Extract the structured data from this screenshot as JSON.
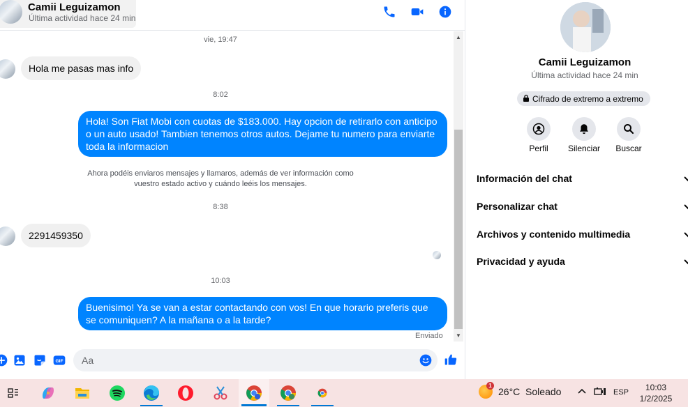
{
  "contact": {
    "name": "Camii Leguizamon",
    "status": "Última actividad hace 24 min"
  },
  "header_icons": [
    "phone-icon",
    "video-camera-icon",
    "info-icon"
  ],
  "conversation": {
    "ts1": "vie, 19:47",
    "msg1": "Hola me pasas mas info",
    "ts2": "8:02",
    "msg2": "Hola! Son Fiat Mobi con cuotas de $183.000. Hay opcion de retirarlo con anticipo o un auto usado! Tambien tenemos otros autos. Dejame tu numero para enviarte toda la informacion",
    "notice": "Ahora podéis enviaros mensajes y llamaros, además de ver información como vuestro estado activo y cuándo leéis los mensajes.",
    "ts3": "8:38",
    "msg3": "2291459350",
    "ts4": "10:03",
    "msg4": "Buenisimo! Ya se van a estar contactando con vos! En que horario preferis que se comuniquen? A la mañana o a la tarde?",
    "sent_status": "Enviado"
  },
  "composer": {
    "placeholder": "Aa",
    "icons": [
      "add-icon",
      "image-icon",
      "sticker-icon",
      "gif-icon",
      "emoji-icon",
      "like-icon"
    ]
  },
  "side_panel": {
    "encryption": "Cifrado de extremo a extremo",
    "actions": {
      "profile": "Perfil",
      "mute": "Silenciar",
      "search": "Buscar"
    },
    "sections": {
      "chat_info": "Información del chat",
      "customize": "Personalizar chat",
      "media": "Archivos y contenido multimedia",
      "privacy": "Privacidad y ayuda"
    }
  },
  "taskbar": {
    "apps": [
      "task-view-icon",
      "copilot-icon",
      "file-explorer-icon",
      "spotify-icon",
      "edge-icon",
      "opera-icon",
      "snipping-tool-icon",
      "chrome-icon",
      "chrome-profile-icon",
      "chrome-small-icon"
    ],
    "weather_badge": "1",
    "weather": "26°C  Soleado",
    "language": "ESP",
    "time": "10:03",
    "date": "1/2/2025"
  },
  "colors": {
    "accent": "#0084ff",
    "messenger_blue": "#0866ff",
    "incoming_bubble": "#f0f0f0",
    "taskbar": "#f7e3e3"
  }
}
